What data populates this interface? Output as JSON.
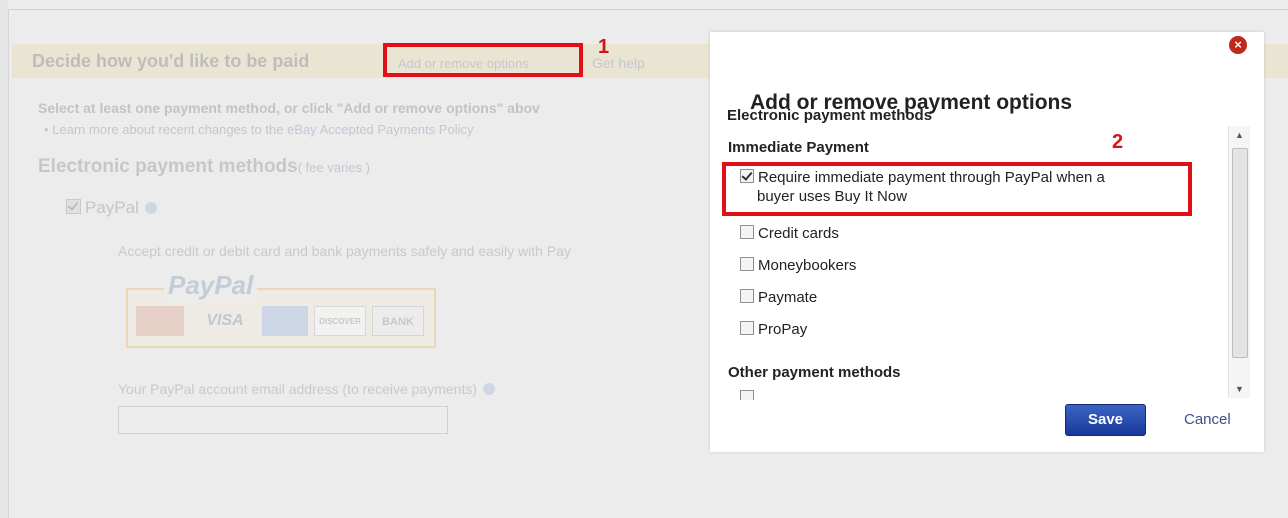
{
  "background": {
    "section_title": "Decide how you'd like to be paid",
    "add_remove_link": "Add or remove options",
    "get_help_link": "Get help",
    "callout_1": "1",
    "instruction": "Select at least one payment method, or click \"Add or remove options\" abov",
    "bullet_prefix": "• Learn more about recent changes to the ",
    "bullet_link": "eBay Accepted Payments Policy",
    "epm_heading": "Electronic payment methods",
    "fee_link": "( fee varies )",
    "paypal_label": "PayPal",
    "accept_text": "Accept credit or debit card and bank payments safely and easily with Pay",
    "paypal_logo": "PayPal",
    "card_visa": "VISA",
    "card_discover": "DISCOVER",
    "card_bank": "BANK",
    "email_label": "Your PayPal account email address (to receive payments)",
    "email_value": ""
  },
  "dialog": {
    "title": "Add or remove payment options",
    "subtitle": "Electronic payment methods",
    "group_immediate": "Immediate Payment",
    "callout_2": "2",
    "options": [
      {
        "label_line1": "Require immediate payment through PayPal when a",
        "label_line2": "buyer uses Buy It Now",
        "checked": true
      },
      {
        "label": "Credit cards",
        "checked": false
      },
      {
        "label": "Moneybookers",
        "checked": false
      },
      {
        "label": "Paymate",
        "checked": false
      },
      {
        "label": "ProPay",
        "checked": false
      }
    ],
    "group_other": "Other payment methods",
    "save_label": "Save",
    "cancel_label": "Cancel",
    "close_glyph": "×"
  },
  "colors": {
    "callout_red": "#e0101a",
    "save_blue": "#1e43a8",
    "close_red": "#c0281c"
  }
}
